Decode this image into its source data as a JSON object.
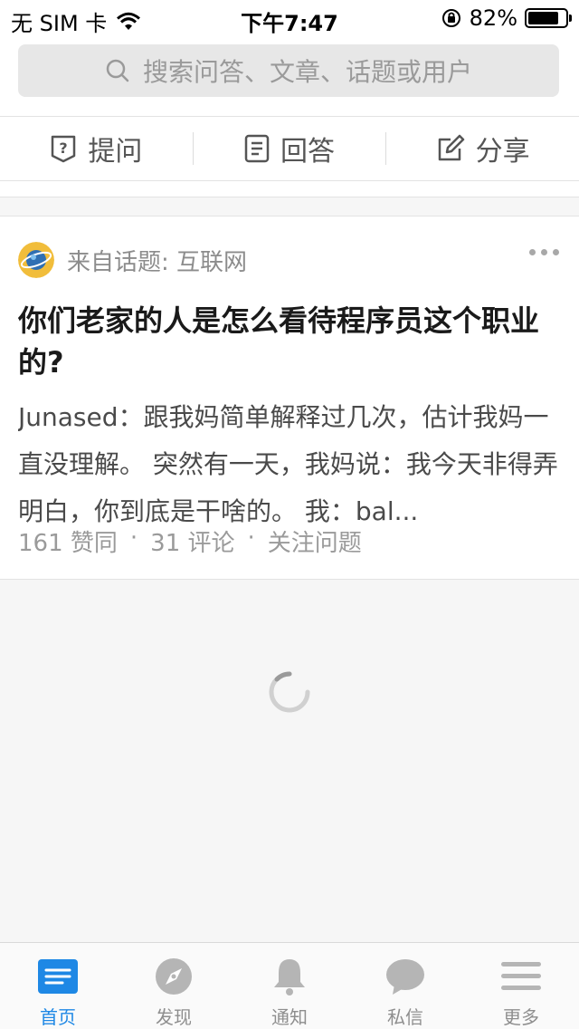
{
  "status_bar": {
    "carrier": "无 SIM 卡",
    "time": "下午7:47",
    "battery": "82%",
    "battery_level": 0.82
  },
  "search": {
    "placeholder": "搜索问答、文章、话题或用户"
  },
  "actions": [
    {
      "label": "提问",
      "icon": "question-icon"
    },
    {
      "label": "回答",
      "icon": "document-icon"
    },
    {
      "label": "分享",
      "icon": "edit-icon"
    }
  ],
  "feed": {
    "card": {
      "topic": "来自话题: 互联网",
      "question": "你们老家的人是怎么看待程序员这个职业的?",
      "excerpt": "Junased：跟我妈简单解释过几次，估计我妈一直没理解。 突然有一天，我妈说：我今天非得弄明白，你到底是干啥的。 我：bal...",
      "likes": "161 赞同",
      "comments": "31 评论",
      "follow": "关注问题",
      "separator": "·"
    }
  },
  "tabbar": {
    "items": [
      {
        "label": "首页",
        "icon": "home-feed-icon",
        "active": true
      },
      {
        "label": "发现",
        "icon": "compass-icon",
        "active": false
      },
      {
        "label": "通知",
        "icon": "bell-icon",
        "active": false
      },
      {
        "label": "私信",
        "icon": "chat-bubble-icon",
        "active": false
      },
      {
        "label": "更多",
        "icon": "menu-icon",
        "active": false
      }
    ]
  },
  "colors": {
    "accent": "#1e88e5",
    "inactive_icon": "#b5b5b5"
  }
}
